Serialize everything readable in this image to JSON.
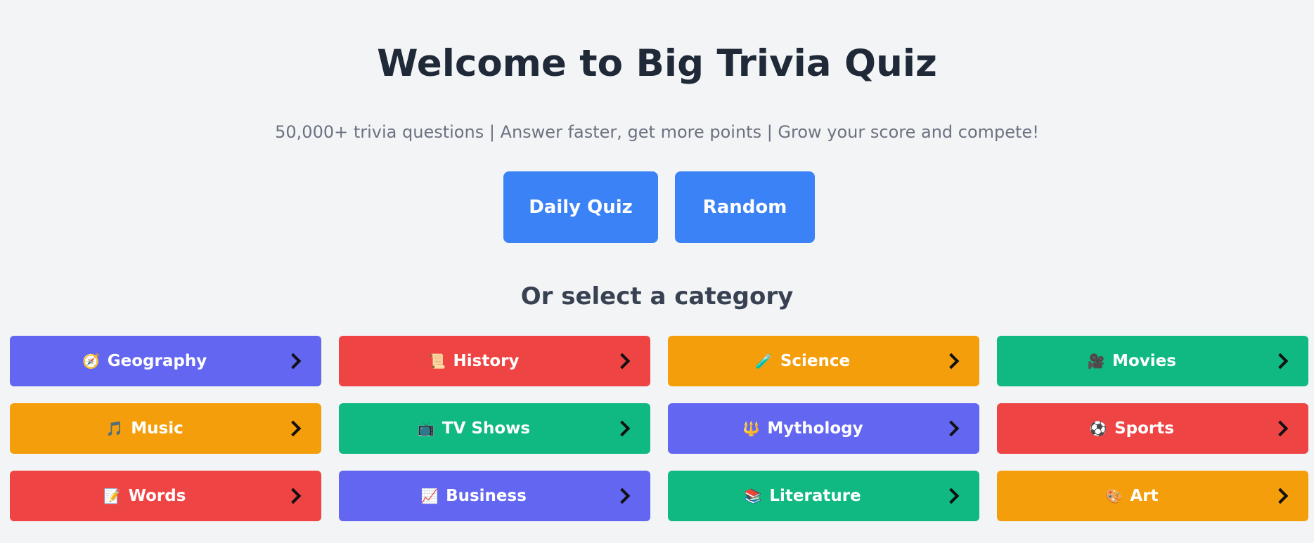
{
  "header": {
    "title": "Welcome to Big Trivia Quiz",
    "subtitle": "50,000+ trivia questions | Answer faster, get more points | Grow your score and compete!"
  },
  "actions": {
    "daily_label": "Daily Quiz",
    "random_label": "Random"
  },
  "categories_section": {
    "heading": "Or select a category",
    "items": [
      {
        "label": "Geography",
        "emoji": "🧭",
        "icon_name": "compass-icon",
        "color": "#6366f1"
      },
      {
        "label": "History",
        "emoji": "📜",
        "icon_name": "scroll-icon",
        "color": "#ef4444"
      },
      {
        "label": "Science",
        "emoji": "🧪",
        "icon_name": "test-tube-icon",
        "color": "#f59e0b"
      },
      {
        "label": "Movies",
        "emoji": "🎥",
        "icon_name": "movie-camera-icon",
        "color": "#10b981"
      },
      {
        "label": "Music",
        "emoji": "🎵",
        "icon_name": "music-note-icon",
        "color": "#f59e0b"
      },
      {
        "label": "TV Shows",
        "emoji": "📺",
        "icon_name": "television-icon",
        "color": "#10b981"
      },
      {
        "label": "Mythology",
        "emoji": "🔱",
        "icon_name": "trident-icon",
        "color": "#6366f1"
      },
      {
        "label": "Sports",
        "emoji": "⚽",
        "icon_name": "soccer-ball-icon",
        "color": "#ef4444"
      },
      {
        "label": "Words",
        "emoji": "📝",
        "icon_name": "memo-icon",
        "color": "#ef4444"
      },
      {
        "label": "Business",
        "emoji": "📈",
        "icon_name": "chart-increasing-icon",
        "color": "#6366f1"
      },
      {
        "label": "Literature",
        "emoji": "📚",
        "icon_name": "books-icon",
        "color": "#10b981"
      },
      {
        "label": "Art",
        "emoji": "🎨",
        "icon_name": "palette-icon",
        "color": "#f59e0b"
      }
    ]
  },
  "colors": {
    "background": "#f3f4f6",
    "primary_button": "#3b82f6",
    "title_text": "#1f2937",
    "subtitle_text": "#6b7280"
  }
}
